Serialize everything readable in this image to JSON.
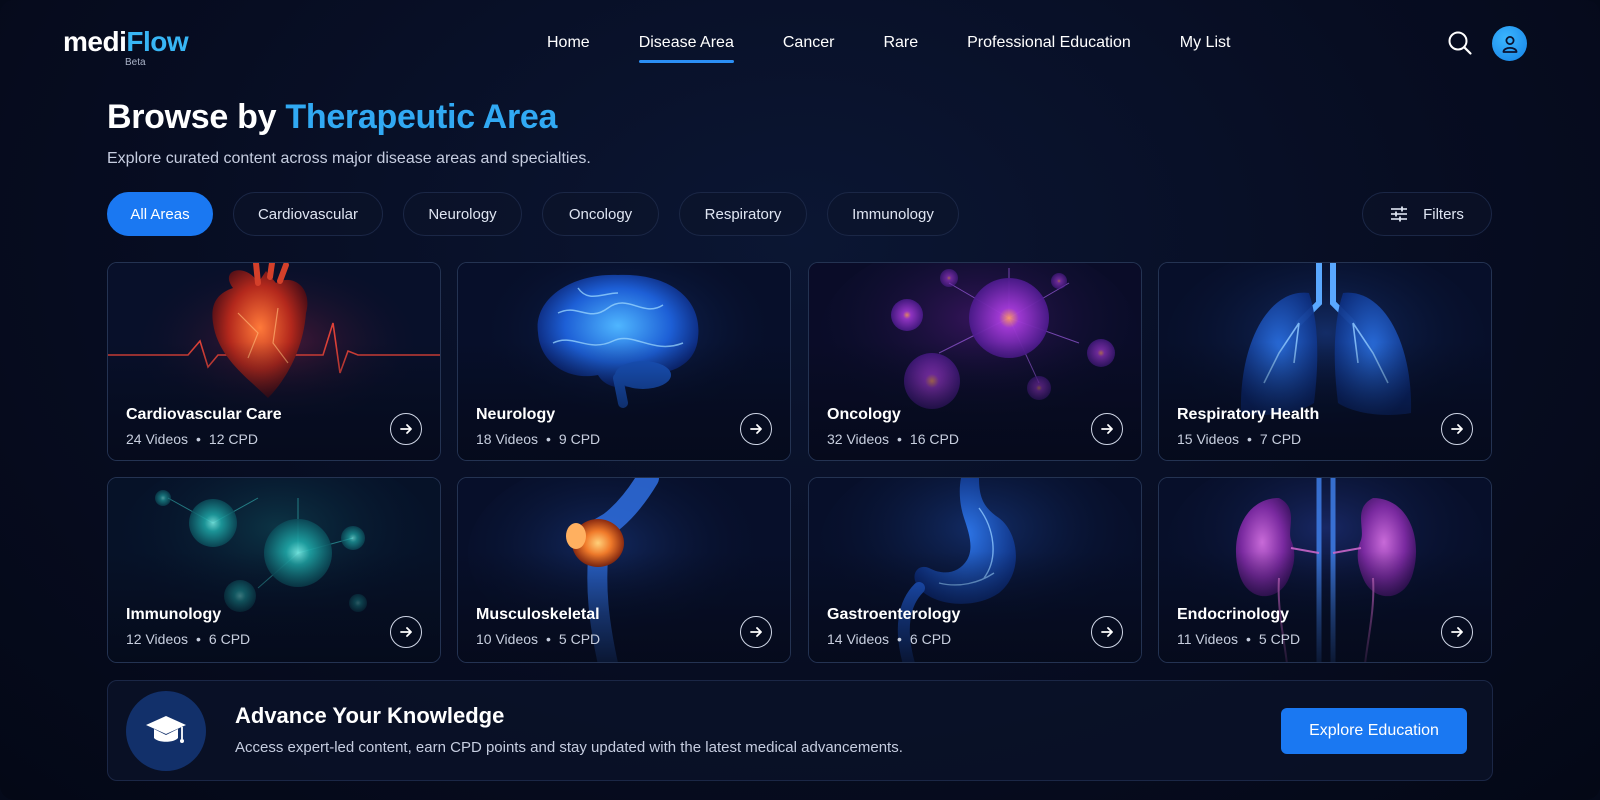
{
  "app": {
    "logo_main": "medi",
    "logo_accent": "Flow",
    "logo_badge": "Beta"
  },
  "nav": {
    "items": [
      {
        "label": "Home"
      },
      {
        "label": "Disease Area",
        "active": true
      },
      {
        "label": "Cancer"
      },
      {
        "label": "Rare"
      },
      {
        "label": "Professional Education"
      },
      {
        "label": "My List"
      }
    ],
    "search_icon": "search-icon",
    "avatar_icon": "user-icon"
  },
  "page": {
    "title_prefix": "Browse by ",
    "title_accent": "Therapeutic Area",
    "subtitle": "Explore curated content across major disease areas and specialties."
  },
  "filters": {
    "chips": [
      {
        "label": "All Areas",
        "active": true
      },
      {
        "label": "Cardiovascular"
      },
      {
        "label": "Neurology"
      },
      {
        "label": "Oncology"
      },
      {
        "label": "Respiratory"
      },
      {
        "label": "Immunology"
      }
    ],
    "filters_label": "Filters"
  },
  "cards": [
    {
      "title": "Cardiovascular Care",
      "videos": "24 Videos",
      "cpd": "12 CPD",
      "art": "heart"
    },
    {
      "title": "Neurology",
      "videos": "18 Videos",
      "cpd": "9 CPD",
      "art": "brain"
    },
    {
      "title": "Oncology",
      "videos": "32 Videos",
      "cpd": "16 CPD",
      "art": "cells-purple"
    },
    {
      "title": "Respiratory Health",
      "videos": "15 Videos",
      "cpd": "7 CPD",
      "art": "lungs"
    },
    {
      "title": "Immunology",
      "videos": "12 Videos",
      "cpd": "6 CPD",
      "art": "cells-teal"
    },
    {
      "title": "Musculoskeletal",
      "videos": "10 Videos",
      "cpd": "5 CPD",
      "art": "knee"
    },
    {
      "title": "Gastroenterology",
      "videos": "14 Videos",
      "cpd": "6 CPD",
      "art": "stomach"
    },
    {
      "title": "Endocrinology",
      "videos": "11 Videos",
      "cpd": "5 CPD",
      "art": "kidneys"
    }
  ],
  "banner": {
    "title": "Advance Your Knowledge",
    "text": "Access expert-led content, earn CPD points and stay updated with the latest medical advancements.",
    "button_label": "Explore Education",
    "icon": "graduation-cap-icon"
  },
  "colors": {
    "accent": "#31a9f3",
    "primary_button": "#1a78f2",
    "background": "#070d22"
  }
}
